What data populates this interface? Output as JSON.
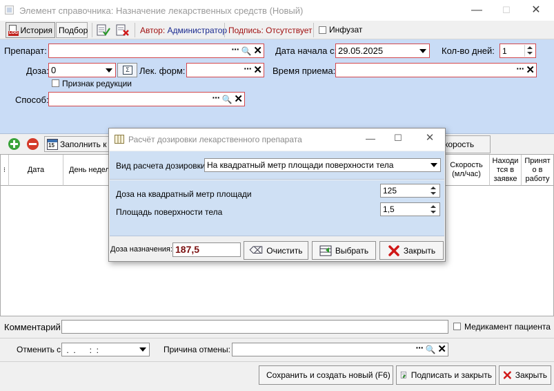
{
  "window": {
    "title": "Элемент справочника: Назначение лекарственных средств (Новый)",
    "minimize": "—",
    "maximize": "☐",
    "close": "✕"
  },
  "toolbar": {
    "history_label": "История",
    "history_icon_text": "LOG",
    "selection_label": "Подбор",
    "author_label": "Автор:",
    "author_value": "Администратор",
    "signature_label": "Подпись:",
    "signature_value": "Отсутствует",
    "infusion_label": "Инфузат"
  },
  "form": {
    "drug_label": "Препарат:",
    "drug_value": "",
    "start_date_label": "Дата начала с:",
    "start_date_value": "29.05.2025",
    "days_label": "Кол-во дней:",
    "days_value": "1",
    "dose_label": "Доза:",
    "dose_value": "0",
    "dose_calc_icon_text": "Σ",
    "drug_form_label": "Лек. форм:",
    "drug_form_value": "",
    "intake_time_label": "Время приема:",
    "intake_time_value": "",
    "reduction_label": "Признак редукции",
    "method_label": "Способ:",
    "method_value": ""
  },
  "grid_toolbar": {
    "fill_label": "Заполнить к",
    "fill_icon_text": "15",
    "speed_label": "корость"
  },
  "grid": {
    "columns": {
      "selector": "⁝",
      "date": "Дата",
      "weekday": "День недел",
      "speed": "Скорость (мл/час)",
      "in_request": "Находи тся в заявке",
      "accepted": "Принят о в работу"
    }
  },
  "bottom": {
    "comment_label": "Комментарий:",
    "comment_value": "",
    "patient_drug_label": "Медикамент пациента",
    "cancel_from_label": "Отменить с:",
    "cancel_from_value": " .  .      :  :",
    "cancel_reason_label": "Причина отмены:",
    "cancel_reason_value": "",
    "save_new_label": "Сохранить и создать новый (F6)",
    "sign_close_label": "Подписать и закрыть",
    "close_label": "Закрыть"
  },
  "dialog": {
    "title": "Расчёт дозировки лекарственного препарата",
    "calc_type_label": "Вид расчета дозировки",
    "calc_type_value": "На квадратный метр площади поверхности тела",
    "dose_per_sqm_label": "Доза на квадратный метр площади",
    "dose_per_sqm_value": "125",
    "body_area_label": "Площадь поверхности тела",
    "body_area_value": "1,5",
    "result_label": "Доза назначения:",
    "result_value": "187,5",
    "clear_label": "Очистить",
    "clear_icon_text": "⌫",
    "select_label": "Выбрать",
    "close_label": "Закрыть",
    "minimize": "—",
    "maximize": "☐",
    "close": "✕"
  },
  "colors": {
    "accent_red": "#d3484d",
    "form_bg": "#c9dcf6",
    "dialog_panel_bg": "#cfe0f4",
    "result_text": "#7a1010",
    "status_red": "#a01010",
    "status_blue": "#1a2a90"
  }
}
